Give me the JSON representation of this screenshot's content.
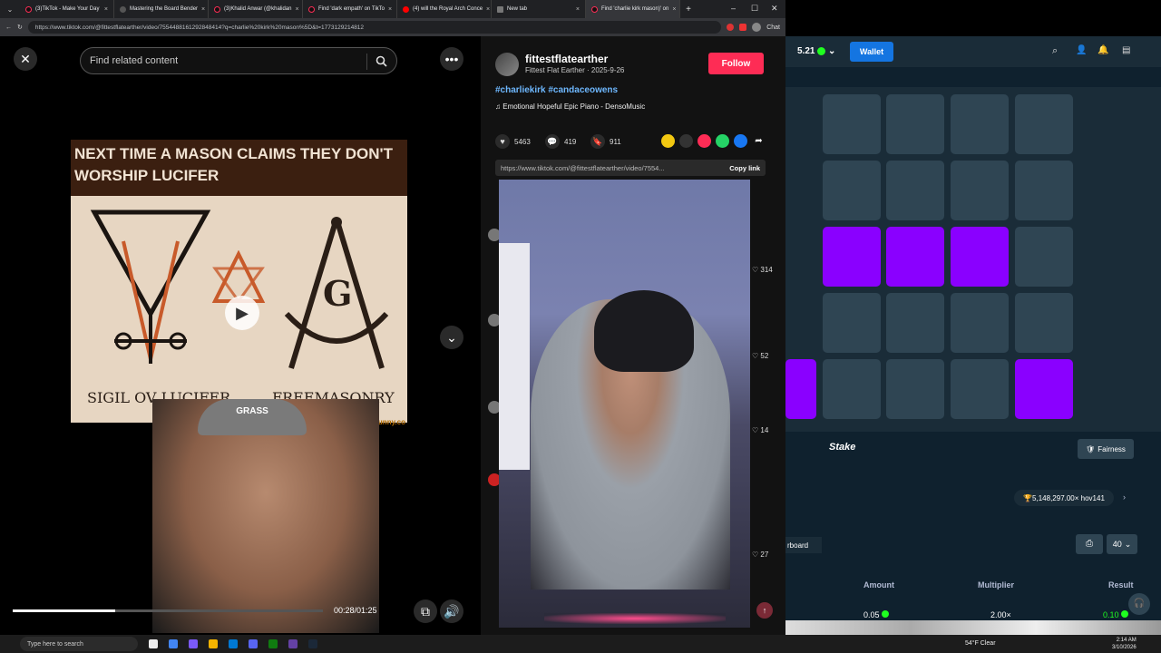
{
  "browser": {
    "tabs": [
      {
        "title": "(3)TikTok - Make Your Day"
      },
      {
        "title": "Mastering the Board Bender"
      },
      {
        "title": "(3)Khalid Anwar (@khalidan"
      },
      {
        "title": "Find 'dark empath' on TikTo"
      },
      {
        "title": "(4) will the Royal Arch Conce"
      },
      {
        "title": "New tab"
      },
      {
        "title": "Find 'charlie kirk mason)' on"
      }
    ],
    "url": "https://www.tiktok.com/@fittestflatearther/video/7554488161292848414?q=charlie%20kirk%20mason%5D&t=1773129214812",
    "chat_label": "Chat"
  },
  "left": {
    "search_placeholder": "Find related content",
    "meme_headline": "NEXT TIME A MASON CLAIMS THEY DON'T WORSHIP LUCIFER",
    "meme_left_label": "SIGIL OV LUCIFER",
    "meme_right_label": "FREEMASONRY",
    "meme_g": "G",
    "watermark": "ifunny.co",
    "cap_text": "GRASS",
    "timecode": "00:28/01:25",
    "progress_fraction": 0.33
  },
  "right": {
    "username": "fittestflatearther",
    "subline": "Fittest Flat Earther · 2025-9-26",
    "follow_label": "Follow",
    "hashtags": "#charliekirk #candaceowens",
    "music": "Emotional Hopeful Epic Piano - DensoMusic",
    "likes": "5463",
    "comments": "419",
    "saves": "911",
    "link": "https://www.tiktok.com/@fittestflatearther/video/7554...",
    "copy_link": "Copy link",
    "comment_likes": [
      "314",
      "52",
      "14",
      "27"
    ]
  },
  "stake": {
    "balance": "5.21",
    "wallet_label": "Wallet",
    "logo": "Stake",
    "fairness_label": "Fairness",
    "jackpot": "5,148,297.00× hov141",
    "board_label": "rboard",
    "page_size": "40",
    "col_amount": "Amount",
    "col_multiplier": "Multiplier",
    "col_result": "Result",
    "row_amount": "0.05",
    "row_multiplier": "2.00×",
    "row_result": "0.10",
    "colors": {
      "accent": "#8a00ff",
      "tile": "#2f4553",
      "bg": "#0f212e"
    }
  },
  "taskbar": {
    "search_placeholder": "Type here to search",
    "weather": "54°F Clear",
    "time": "2:14 AM",
    "date": "3/10/2026"
  }
}
